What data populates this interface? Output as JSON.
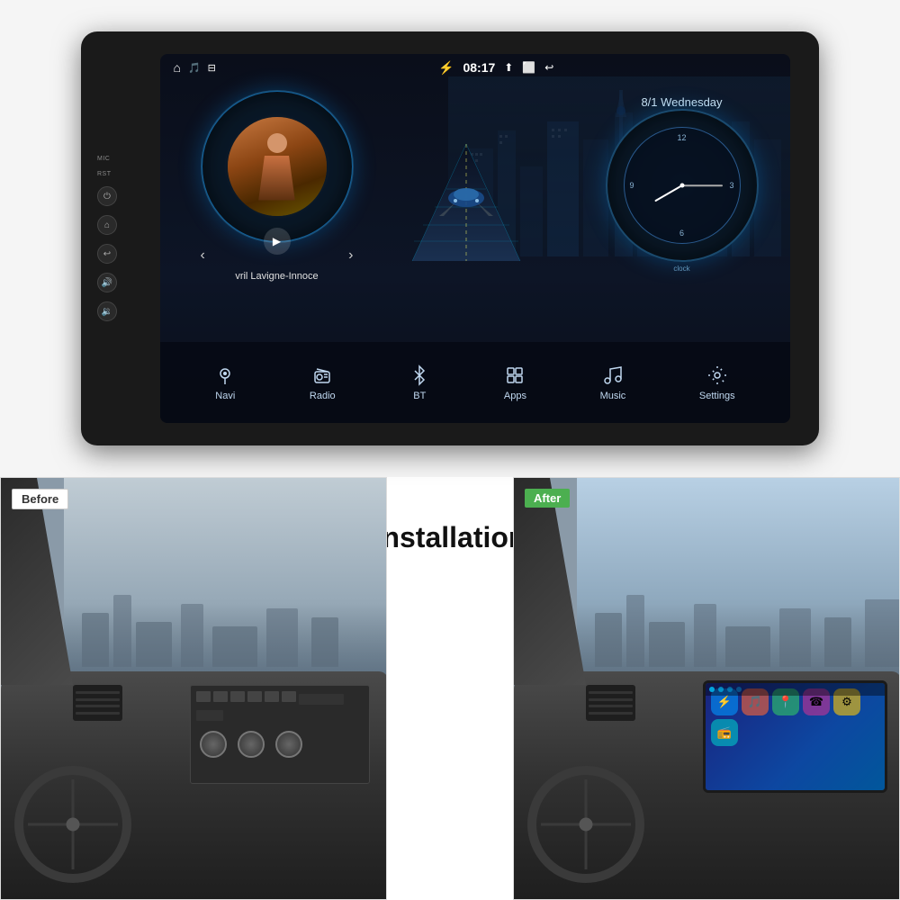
{
  "headUnit": {
    "labels": {
      "mic": "MIC",
      "rst": "RST"
    },
    "statusBar": {
      "bluetooth": "⚡",
      "time": "08:17",
      "signal": "⬆",
      "window": "⬜",
      "back": "↩"
    },
    "topLeft": [
      "⌂",
      "🎵",
      "⊟"
    ],
    "songTitle": "vril Lavigne-Innoce",
    "date": "8/1 Wednesday",
    "clockLabel": "clock",
    "navItems": [
      {
        "icon": "📍",
        "label": "Navi",
        "unicode": "◎"
      },
      {
        "icon": "📷",
        "label": "Radio",
        "unicode": "⊙"
      },
      {
        "icon": "🔵",
        "label": "BT",
        "unicode": "⚡"
      },
      {
        "icon": "⊞",
        "label": "Apps",
        "unicode": "⊞"
      },
      {
        "icon": "♪",
        "label": "Music",
        "unicode": "♪"
      },
      {
        "icon": "⚙",
        "label": "Settings",
        "unicode": "⚙"
      }
    ]
  },
  "bottomSection": {
    "beforeLabel": "Before",
    "afterLabel": "After",
    "installationTitle": "Installation"
  }
}
